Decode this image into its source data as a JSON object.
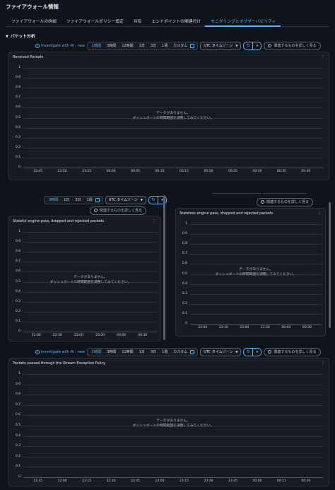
{
  "page": {
    "title": "ファイアウォール情報",
    "tabs": [
      "ファイアウォールの詳細",
      "ファイアウォールポリシー設定",
      "共有",
      "エンドポイントの関連付け",
      "モニタリングとオブザーバビリティ"
    ],
    "active_tab": "モニタリングとオブザーバビリティ",
    "section": "パケット分析"
  },
  "toolbar": {
    "ai_link": "Investigate with AI - new",
    "ranges": [
      "1時間",
      "3時間",
      "12時間",
      "1日",
      "3日",
      "1週"
    ],
    "ranges_short": [
      "3時間",
      "1日",
      "3日",
      "1週"
    ],
    "selected_range": "1時間",
    "selected_range_short": "3時間",
    "custom": "カスタム",
    "timezone": "UTC タイムゾーン",
    "refresh": "↻",
    "dropdown": "▼",
    "explore": "関連するものを詳しく見る"
  },
  "empty_message": {
    "line1": "データがありません。",
    "line2": "ダッシュボードの時間範囲を調整してみてください。"
  },
  "chart_data": [
    {
      "type": "line",
      "title": "Received Packets",
      "y_ticks": [
        "1",
        "0.9",
        "0.8",
        "0.7",
        "0.6",
        "0.5",
        "0.4",
        "0.3",
        "0.2",
        "0.1",
        "0"
      ],
      "x_ticks": [
        "23:45",
        "23:50",
        "23:55",
        "00:00",
        "00:05",
        "00:10",
        "00:15",
        "00:20",
        "00:25",
        "00:30",
        "00:35",
        "00:40"
      ],
      "series": []
    },
    {
      "type": "line",
      "title": "Stateful engine pass, dropped and rejected packets",
      "y_ticks": [
        "1",
        "0.9",
        "0.8",
        "0.7",
        "0.6",
        "0.5",
        "0.4",
        "0.3",
        "0.2",
        "0.1",
        "0"
      ],
      "x_ticks": [
        "22:00",
        "22:30",
        "23:00",
        "23:30",
        "00:00",
        "00:30"
      ],
      "series": []
    },
    {
      "type": "line",
      "title": "Stateless engine pass, dropped and rejected packets",
      "y_ticks": [
        "1",
        "0.9",
        "0.8",
        "0.7",
        "0.6",
        "0.5",
        "0.4",
        "0.3",
        "0.2",
        "0.1",
        "0"
      ],
      "x_ticks": [
        "22:00",
        "22:30",
        "23:00",
        "23:30",
        "00:00",
        "00:30"
      ],
      "series": []
    },
    {
      "type": "line",
      "title": "Packets passed through the Stream Exception Policy",
      "y_ticks": [
        "1",
        "0.9",
        "0.8",
        "0.7",
        "0.6",
        "0.5",
        "0.4",
        "0.3",
        "0.2",
        "0.1",
        "0"
      ],
      "x_ticks": [
        "21:45",
        "22:00",
        "22:15",
        "22:30",
        "22:45",
        "23:00",
        "23:15",
        "23:30",
        "23:45",
        "00:00",
        "00:15",
        "00:30"
      ],
      "series": []
    }
  ]
}
